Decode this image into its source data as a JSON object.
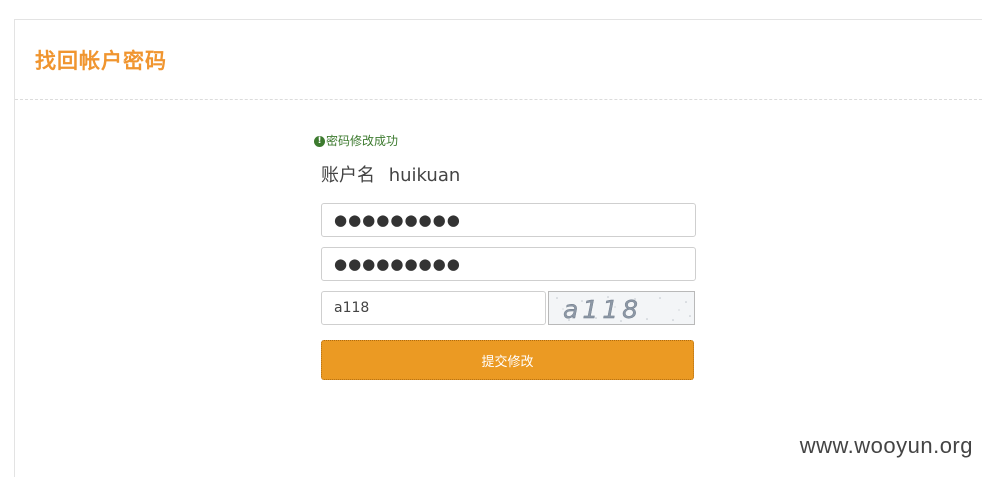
{
  "page": {
    "title": "找回帐户密码"
  },
  "form": {
    "success_message": "密码修改成功",
    "account_label": "账户名",
    "account_value": "huikuan",
    "new_password_value": "●●●●●●●●●",
    "confirm_password_value": "●●●●●●●●●",
    "captcha_value": "a118",
    "captcha_image_text": "a118",
    "submit_label": "提交修改"
  },
  "watermark": {
    "text": "www.wooyun.org"
  },
  "colors": {
    "title": "#f0952f",
    "success": "#3c7a2e",
    "submit_bg": "#eb9a23"
  },
  "icons": {
    "success_icon": "exclamation-circle-icon"
  }
}
